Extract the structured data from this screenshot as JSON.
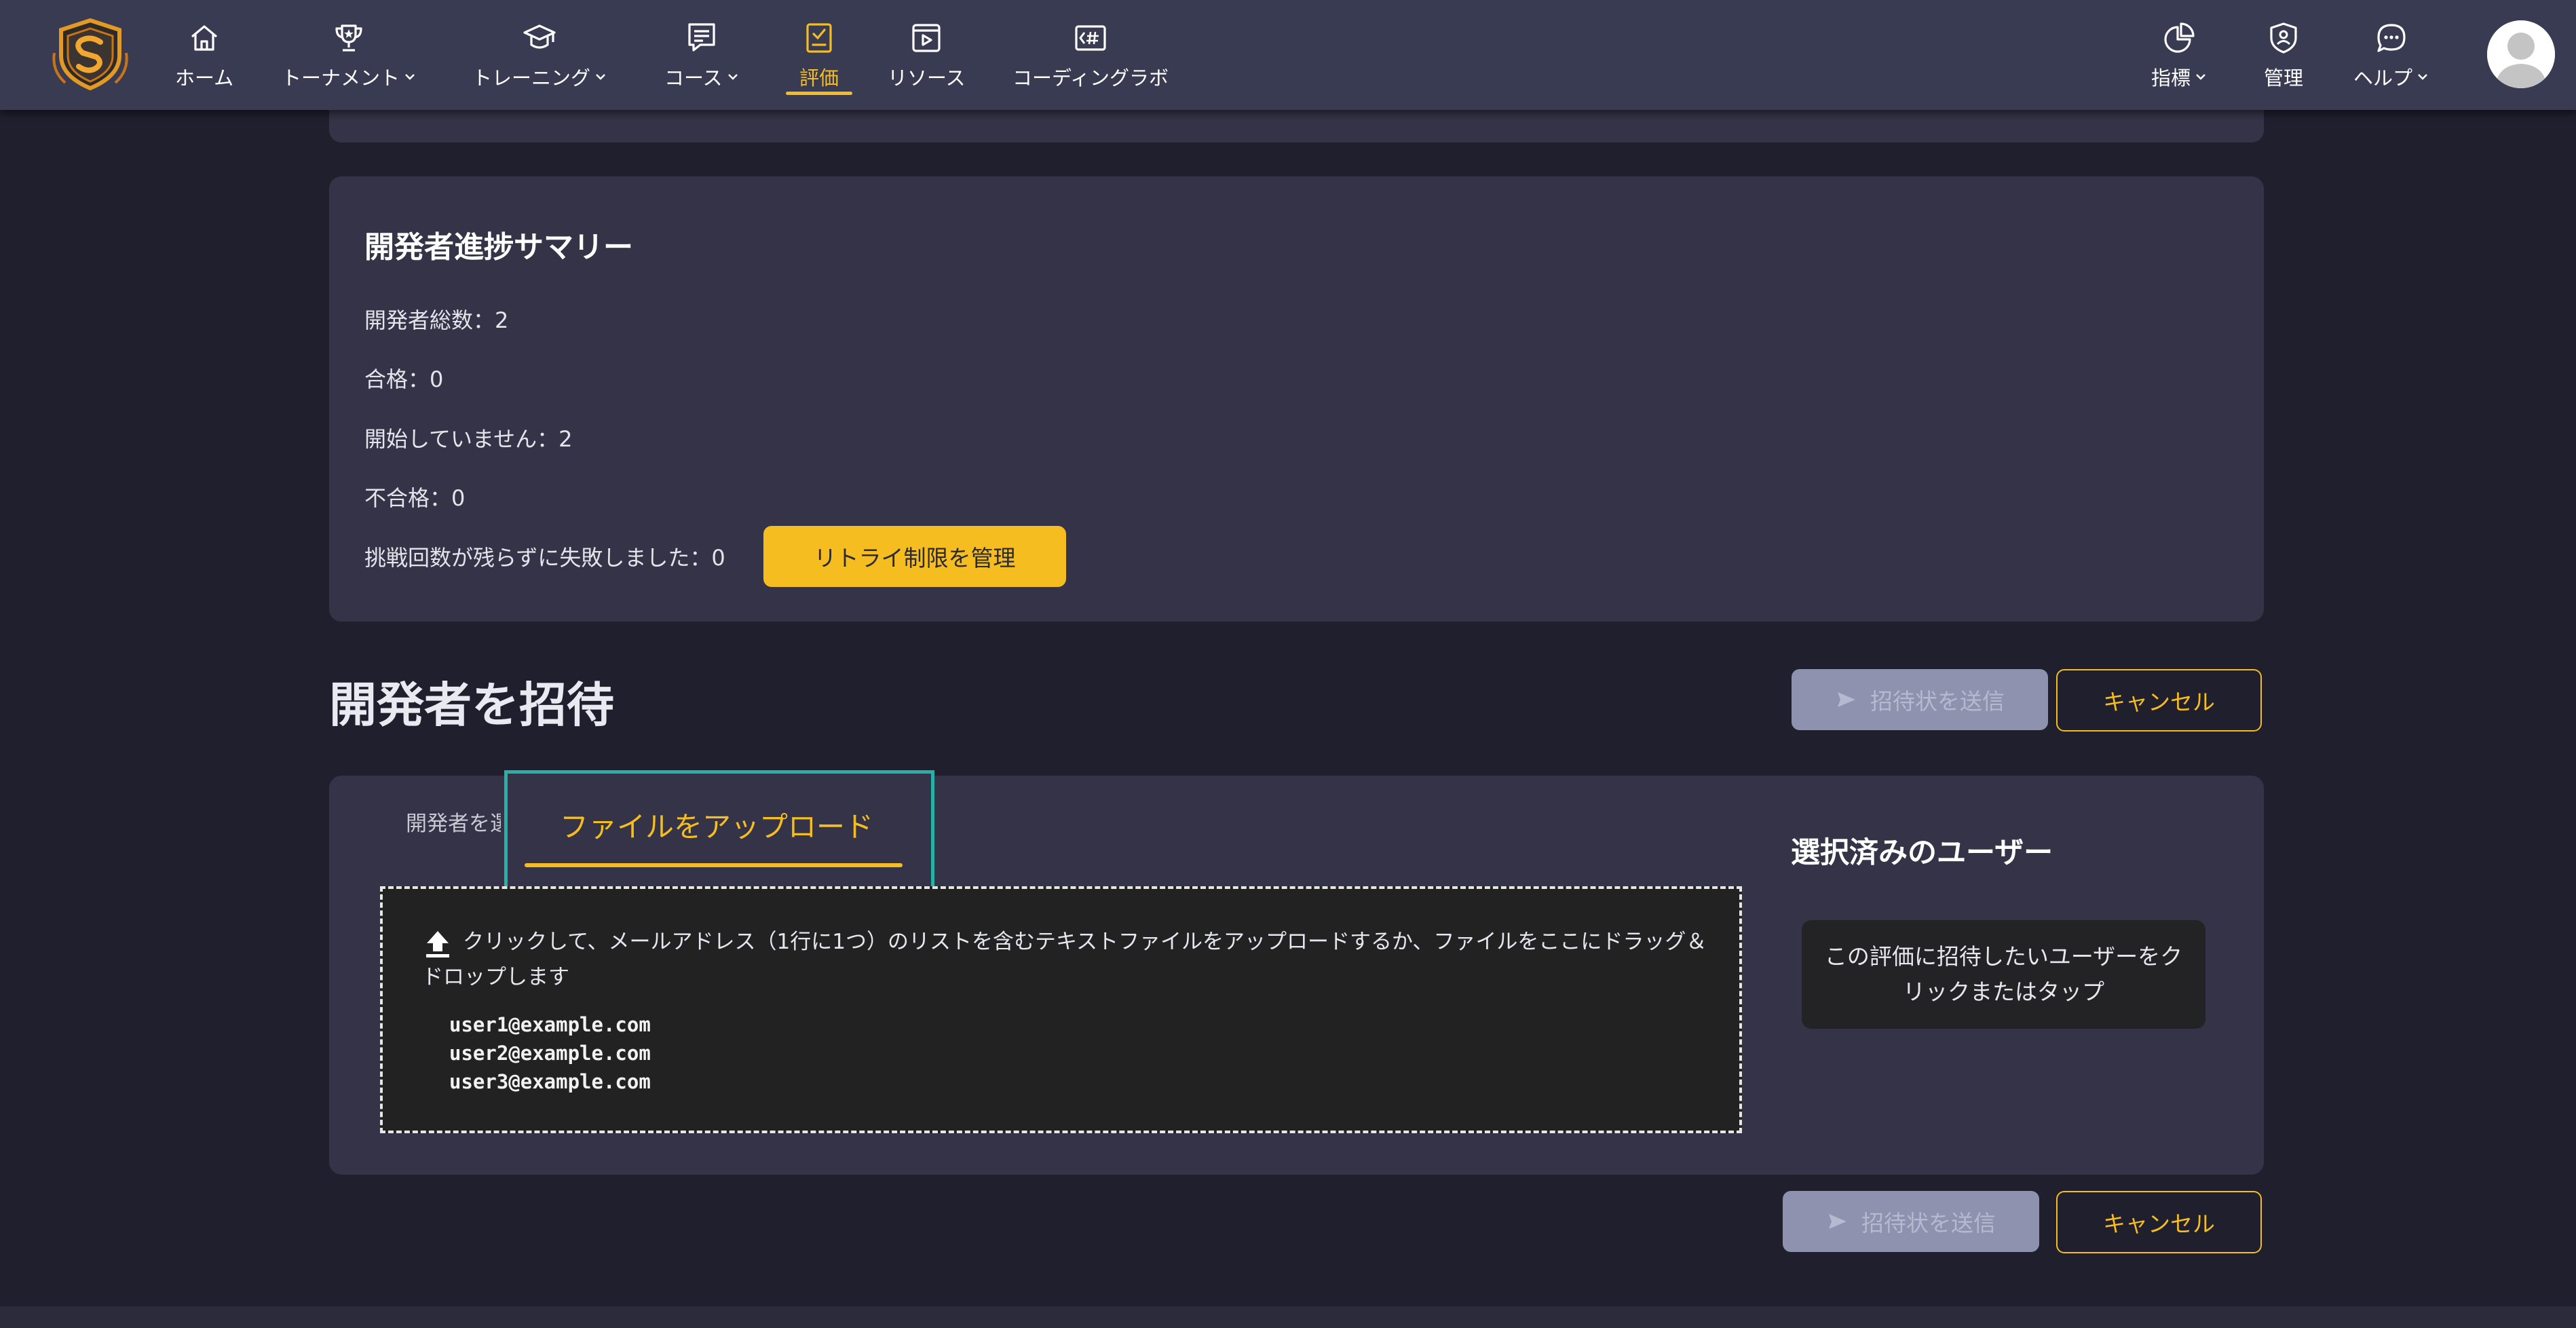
{
  "nav": {
    "items": [
      {
        "label": "ホーム",
        "icon": "home-icon",
        "dropdown": false
      },
      {
        "label": "トーナメント",
        "icon": "trophy-icon",
        "dropdown": true
      },
      {
        "label": "トレーニング",
        "icon": "graduation-cap-icon",
        "dropdown": true
      },
      {
        "label": "コース",
        "icon": "course-icon",
        "dropdown": true
      },
      {
        "label": "評価",
        "icon": "assessment-icon",
        "dropdown": false,
        "active": true
      },
      {
        "label": "リソース",
        "icon": "video-resource-icon",
        "dropdown": false
      },
      {
        "label": "コーディングラボ",
        "icon": "code-icon",
        "dropdown": false
      }
    ],
    "right_items": [
      {
        "label": "指標",
        "icon": "pie-chart-icon",
        "dropdown": true
      },
      {
        "label": "管理",
        "icon": "admin-icon",
        "dropdown": false
      },
      {
        "label": "ヘルプ",
        "icon": "chat-help-icon",
        "dropdown": true
      }
    ]
  },
  "summary": {
    "title": "開発者進捗サマリー",
    "total": "開発者総数：2",
    "passed": "合格：0",
    "not_started": "開始していません：2",
    "failed": "不合格：0",
    "exhausted": "挑戦回数が残らずに失敗しました：0",
    "retry_button": "リトライ制限を管理"
  },
  "invite": {
    "heading": "開発者を招待",
    "send_button": "招待状を送信",
    "cancel_button": "キャンセル",
    "tab_invite": "開発者を選択",
    "tab_upload": "ファイルをアップロード",
    "dropzone_text": "クリックして、メールアドレス（1行に1つ）のリストを含むテキストファイルをアップロードするか、ファイルをここにドラッグ＆ドロップします",
    "example_emails": [
      "user1@example.com",
      "user2@example.com",
      "user3@example.com"
    ],
    "selected_title": "選択済みのユーザー",
    "selected_placeholder": "この評価に招待したいユーザーをクリックまたはタップ"
  },
  "colors": {
    "accent": "#f5bd1f",
    "focus_ring": "#25b1a7",
    "nav_bg": "#383b52",
    "panel_bg": "#343347",
    "page_bg": "#1f1f2e"
  }
}
